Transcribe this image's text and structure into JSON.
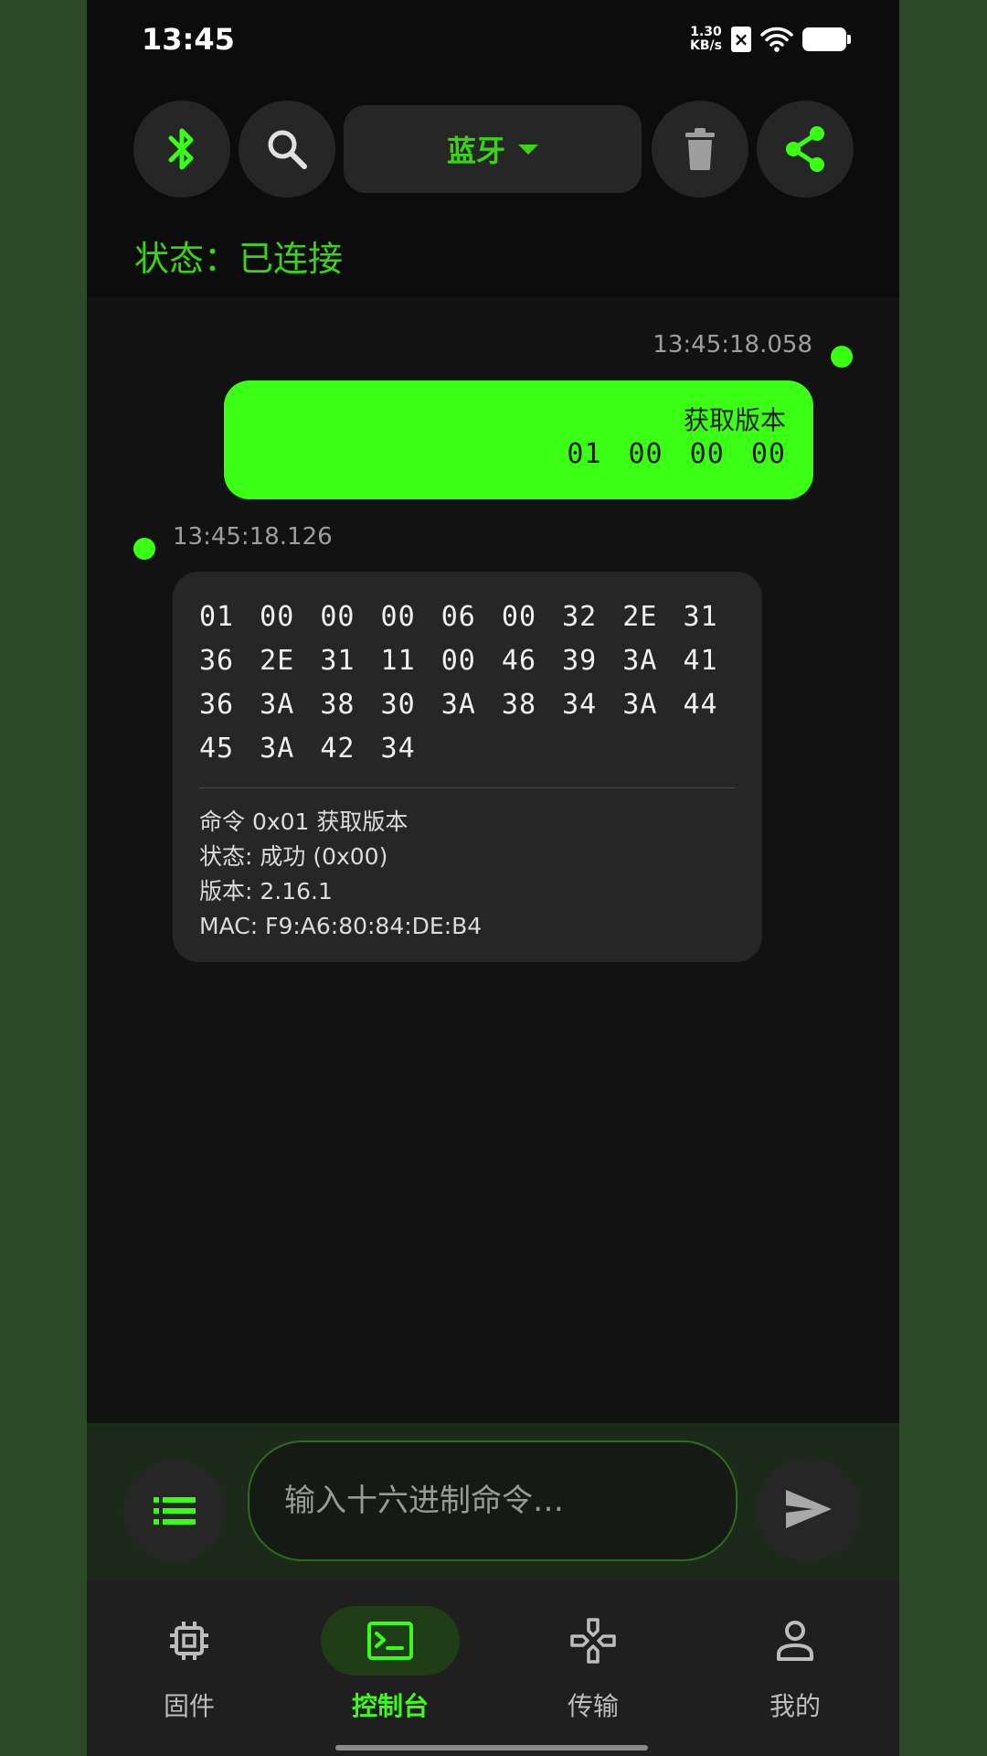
{
  "status_bar": {
    "time": "13:45",
    "net_speed_value": "1.30",
    "net_speed_unit": "KB/s"
  },
  "toolbar": {
    "connection_type": "蓝牙",
    "status_text": "状态：已连接"
  },
  "messages": {
    "sent": {
      "timestamp": "13:45:18.058",
      "label": "获取版本",
      "hex": "01 00 00 00"
    },
    "received": {
      "timestamp": "13:45:18.126",
      "hex_lines": [
        "01 00 00 00 06 00 32 2E 31",
        "36 2E 31 11 00 46 39 3A 41",
        "36 3A 38 30 3A 38 34 3A 44",
        "45 3A 42 34"
      ],
      "decoded": [
        "命令 0x01 获取版本",
        "状态: 成功 (0x00)",
        "版本: 2.16.1",
        "MAC: F9:A6:80:84:DE:B4"
      ]
    }
  },
  "input": {
    "placeholder": "输入十六进制命令…"
  },
  "nav": {
    "items": [
      {
        "label": "固件"
      },
      {
        "label": "控制台"
      },
      {
        "label": "传输"
      },
      {
        "label": "我的"
      }
    ]
  },
  "colors": {
    "accent": "#39ff14",
    "accent_text": "#39d416",
    "background": "#121212",
    "surface": "#262626"
  }
}
